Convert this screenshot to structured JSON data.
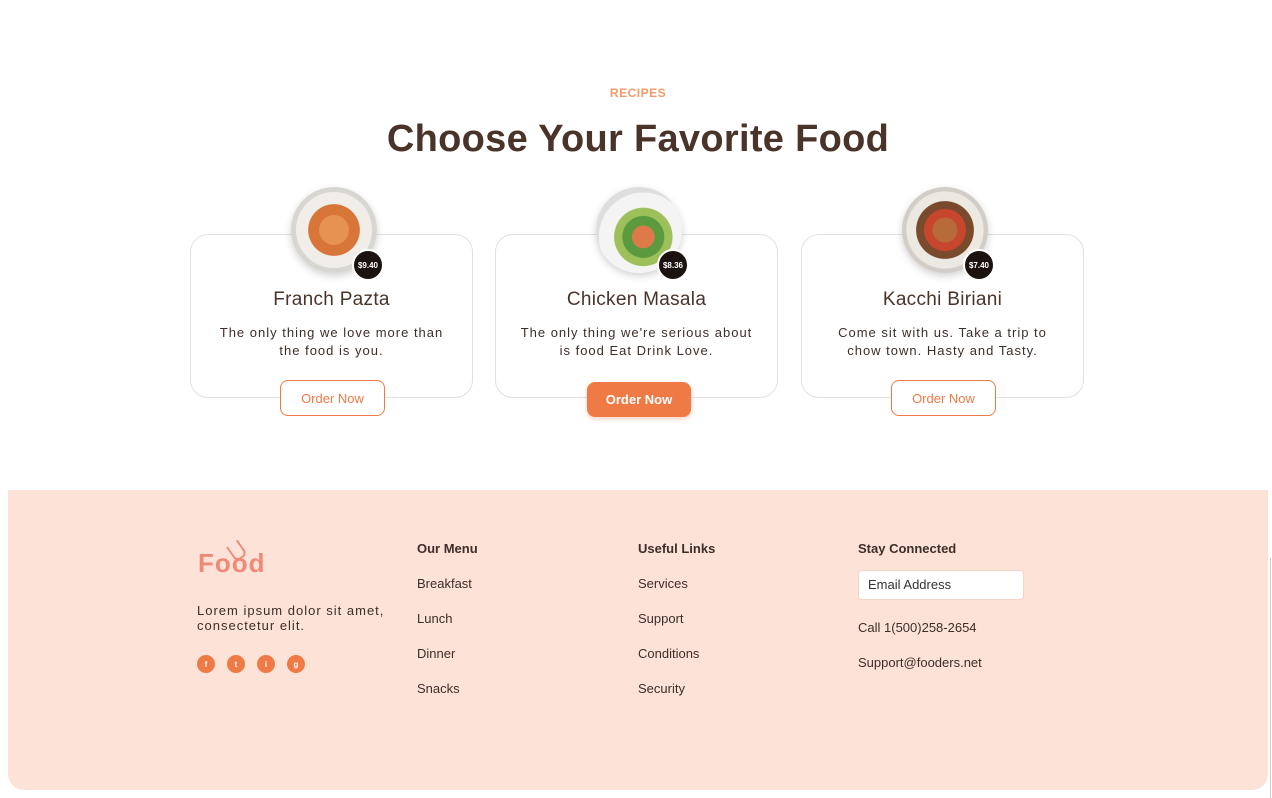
{
  "section": {
    "eyebrow": "RECIPES",
    "title": "Choose Your Favorite Food"
  },
  "cards": [
    {
      "title": "Franch Pazta",
      "price": "$9.40",
      "description": "The only thing we love more than the food is you.",
      "button": "Order Now",
      "button_style": "outline"
    },
    {
      "title": "Chicken Masala",
      "price": "$8.36",
      "description": "The only thing we're serious about is food Eat Drink Love.",
      "button": "Order Now",
      "button_style": "filled"
    },
    {
      "title": "Kacchi Biriani",
      "price": "$7.40",
      "description": "Come sit with us. Take a trip to chow town. Hasty and Tasty.",
      "button": "Order Now",
      "button_style": "outline"
    }
  ],
  "footer": {
    "logo_text": "Food",
    "about": "Lorem ipsum dolor sit amet, consectetur elit.",
    "socials": [
      {
        "icon": "facebook-icon",
        "glyph": "f"
      },
      {
        "icon": "twitter-icon",
        "glyph": "t"
      },
      {
        "icon": "instagram-icon",
        "glyph": "i"
      },
      {
        "icon": "google-icon",
        "glyph": "g"
      }
    ],
    "menu": {
      "title": "Our Menu",
      "items": [
        "Breakfast",
        "Lunch",
        "Dinner",
        "Snacks"
      ]
    },
    "links": {
      "title": "Useful Links",
      "items": [
        "Services",
        "Support",
        "Conditions",
        "Security"
      ]
    },
    "connect": {
      "title": "Stay Connected",
      "email_placeholder": "Email Address",
      "phone": "Call 1(500)258-2654",
      "email": "Support@fooders.net"
    }
  },
  "colors": {
    "accent": "#f07a45",
    "heading": "#4a342a",
    "footer_bg": "#fde2d8",
    "eyebrow": "#f4996a"
  }
}
